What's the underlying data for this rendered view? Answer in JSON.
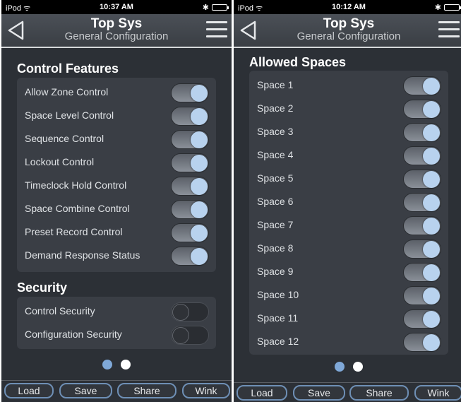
{
  "screens": [
    {
      "status": {
        "carrier": "iPod ᯤ",
        "time": "10:37 AM",
        "bt": "✱"
      },
      "nav": {
        "title": "Top Sys",
        "subtitle": "General Configuration"
      },
      "sections": [
        {
          "title": "Control Features",
          "items": [
            {
              "label": "Allow Zone Control",
              "on": true
            },
            {
              "label": "Space Level Control",
              "on": true
            },
            {
              "label": "Sequence Control",
              "on": true
            },
            {
              "label": "Lockout Control",
              "on": true
            },
            {
              "label": "Timeclock Hold Control",
              "on": true
            },
            {
              "label": "Space Combine Control",
              "on": true
            },
            {
              "label": "Preset Record Control",
              "on": true
            },
            {
              "label": "Demand Response Status",
              "on": true
            }
          ]
        },
        {
          "title": "Security",
          "items": [
            {
              "label": "Control Security",
              "on": false
            },
            {
              "label": "Configuration Security",
              "on": false
            }
          ]
        }
      ],
      "page_dots": {
        "count": 2,
        "active_index": 0
      },
      "toolbar": [
        "Load",
        "Save",
        "Share",
        "Wink"
      ]
    },
    {
      "status": {
        "carrier": "iPod ᯤ",
        "time": "10:12 AM",
        "bt": "✱"
      },
      "nav": {
        "title": "Top Sys",
        "subtitle": "General Configuration"
      },
      "sections": [
        {
          "title": "Allowed Spaces",
          "items": [
            {
              "label": "Space 1",
              "on": true
            },
            {
              "label": "Space 2",
              "on": true
            },
            {
              "label": "Space 3",
              "on": true
            },
            {
              "label": "Space 4",
              "on": true
            },
            {
              "label": "Space 5",
              "on": true
            },
            {
              "label": "Space 6",
              "on": true
            },
            {
              "label": "Space 7",
              "on": true
            },
            {
              "label": "Space 8",
              "on": true
            },
            {
              "label": "Space 9",
              "on": true
            },
            {
              "label": "Space 10",
              "on": true
            },
            {
              "label": "Space 11",
              "on": true
            },
            {
              "label": "Space 12",
              "on": true
            }
          ]
        }
      ],
      "page_dots": {
        "count": 2,
        "active_index": 0
      },
      "toolbar": [
        "Load",
        "Save",
        "Share",
        "Wink"
      ]
    }
  ],
  "colors": {
    "background": "#2c3036",
    "panel": "#3a3e45",
    "accent": "#7fa8d8",
    "toggle_knob": "#b8d2ee"
  }
}
